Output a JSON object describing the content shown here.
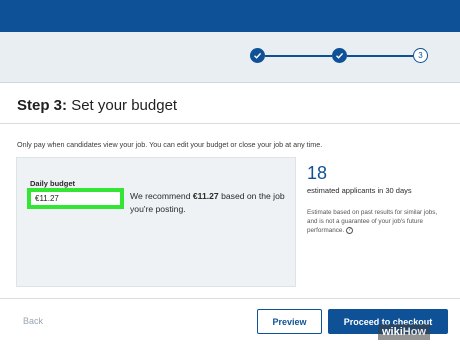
{
  "stepper": {
    "steps": [
      {
        "state": "done",
        "icon": "checkmark-icon"
      },
      {
        "state": "done",
        "icon": "checkmark-icon"
      },
      {
        "state": "current",
        "label": "3"
      }
    ]
  },
  "card": {
    "step_prefix": "Step 3:",
    "title": "Set your budget",
    "info": "Only pay when candidates view your job. You can edit your budget or close your job at any time."
  },
  "budget": {
    "label": "Daily budget",
    "value": "€11.27",
    "recommend_prefix": "We recommend ",
    "recommend_amount": "€11.27",
    "recommend_suffix": " based on the job you're posting."
  },
  "estimate": {
    "count": "18",
    "label": "estimated applicants in 30 days",
    "note": "Estimate based on past results for similar jobs, and is not a guarantee of your job's future performance.",
    "help_icon": "question-icon"
  },
  "footer": {
    "back_label": "Back",
    "preview_label": "Preview",
    "checkout_label": "Proceed to checkout"
  },
  "watermark": {
    "part1": "wiki",
    "part2": "How"
  },
  "colors": {
    "brand": "#0f5197",
    "highlight": "#33e633"
  }
}
